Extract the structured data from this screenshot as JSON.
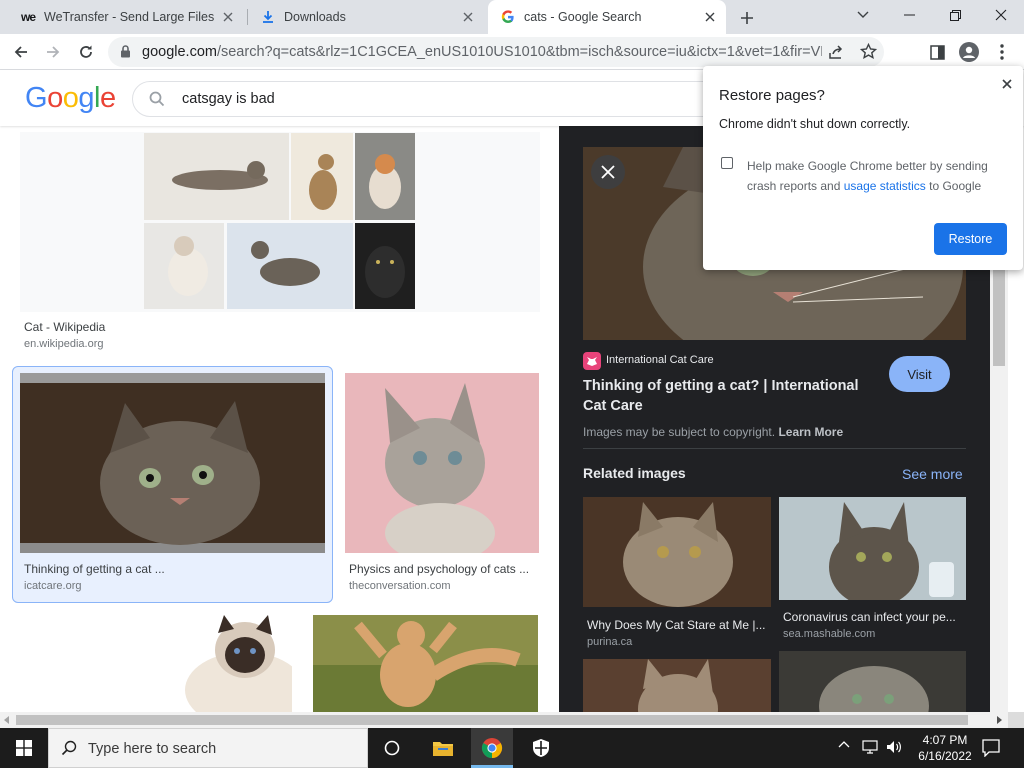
{
  "browser": {
    "tabs": [
      {
        "title": "WeTransfer - Send Large Files & ",
        "favicon": "wetransfer-logo"
      },
      {
        "title": "Downloads",
        "favicon": "download-icon"
      },
      {
        "title": "cats - Google Search",
        "favicon": "google-g-icon"
      }
    ],
    "url": {
      "host": "google.com",
      "path": "/search?q=cats&rlz=1C1GCEA_enUS1010US1010&tbm=isch&source=iu&ictx=1&vet=1&fir=VRmao..."
    }
  },
  "google": {
    "logo": [
      "G",
      "o",
      "o",
      "g",
      "l",
      "e"
    ],
    "logo_colors": [
      "#4285f4",
      "#ea4335",
      "#fbbc05",
      "#4285f4",
      "#34a853",
      "#ea4335"
    ],
    "search_value": "catsgay is bad"
  },
  "results": [
    {
      "caption": "Cat - Wikipedia",
      "domain": "en.wikipedia.org"
    },
    {
      "caption": "Thinking of getting a cat ...",
      "domain": "icatcare.org"
    },
    {
      "caption": "Physics and psychology of cats ...",
      "domain": "theconversation.com"
    }
  ],
  "panel": {
    "source": "International Cat Care",
    "title_line1": "Thinking of getting a cat? | International",
    "title_line2": "Cat Care",
    "visit": "Visit",
    "copyright": "Images may be subject to copyright.",
    "learn_more": "Learn More",
    "related_heading": "Related images",
    "see_more": "See more",
    "related": [
      {
        "caption": "Why Does My Cat Stare at Me |...",
        "domain": "purina.ca"
      },
      {
        "caption": "Coronavirus can infect your pe...",
        "domain": "sea.mashable.com"
      }
    ]
  },
  "restore_dialog": {
    "title": "Restore pages?",
    "message": "Chrome didn't shut down correctly.",
    "checkbox_text_1": "Help make Google Chrome better by sending",
    "checkbox_text_2a": "crash reports and",
    "checkbox_link": "usage statistics",
    "checkbox_text_2b": "to Google",
    "checkbox_checked": false,
    "button": "Restore"
  },
  "taskbar": {
    "search_placeholder": "Type here to search",
    "time": "4:07 PM",
    "date": "6/16/2022"
  },
  "colors": {
    "accent_blue": "#1a73e8",
    "panel_bg": "#202124",
    "visit_button": "#8ab4f8",
    "taskbar": "#1c1c1c"
  }
}
